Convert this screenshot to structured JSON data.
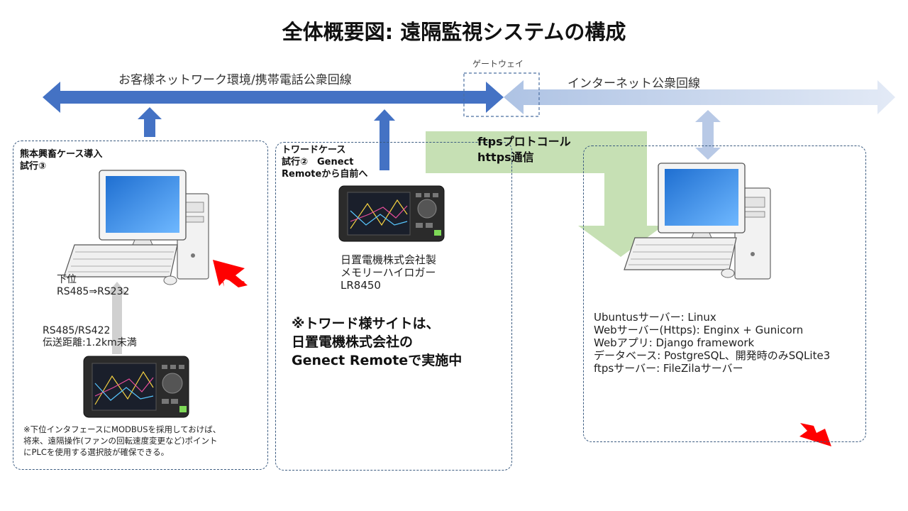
{
  "title": "全体概要図: 遠隔監視システムの構成",
  "network": {
    "customer_label": "お客様ネットワーク環境/携帯電話公衆回線",
    "gateway_label": "ゲートウェイ",
    "internet_label": "インターネット公衆回線"
  },
  "protocol": {
    "line1": "ftpsプロトコール",
    "line2": "https通信"
  },
  "panel_left": {
    "heading_line1": "熊本興畜ケース導入",
    "heading_line2": "試行③",
    "lower_label_line1": "下位",
    "lower_label_line2": "RS485⇒RS232",
    "rs_line1": "RS485/RS422",
    "rs_line2": "伝送距離:1.2km未満",
    "note_line1": "※下位インタフェースにMODBUSを採用しておけば、",
    "note_line2": "将来、遠隔操作(ファンの回転速度変更など)ポイント",
    "note_line3": "にPLCを使用する選択肢が確保できる。"
  },
  "panel_middle": {
    "heading_line1": "トワードケース",
    "heading_line2": "試行②　Genect",
    "heading_line3": "Remoteから自前へ",
    "device_line1": "日置電機株式会社製",
    "device_line2": "メモリーハイロガー",
    "device_line3": "LR8450",
    "callout_line1": "※トワード様サイトは、",
    "callout_line2": "日置電機株式会社の",
    "callout_line3": "Genect Remoteで実施中"
  },
  "panel_right": {
    "server_lines": [
      "Ubuntusサーバー: Linux",
      " Webサーバー(Https): Enginx + Gunicorn",
      " Webアプリ: Django framework",
      " データベース: PostgreSQL、開発時のみSQLite3",
      " ftpsサーバー: FileZilaサーバー"
    ]
  },
  "colors": {
    "customer_arrow": "#4472c4",
    "internet_arrow": "#c9d6ec",
    "protocol_arrow": "#c6e0b4",
    "highlight_arrow": "#ff0000",
    "panel_border": "#3b5b80"
  },
  "icons": [
    "desktop-pc-icon",
    "data-logger-icon",
    "server-pc-icon",
    "red-arrow-icon"
  ]
}
